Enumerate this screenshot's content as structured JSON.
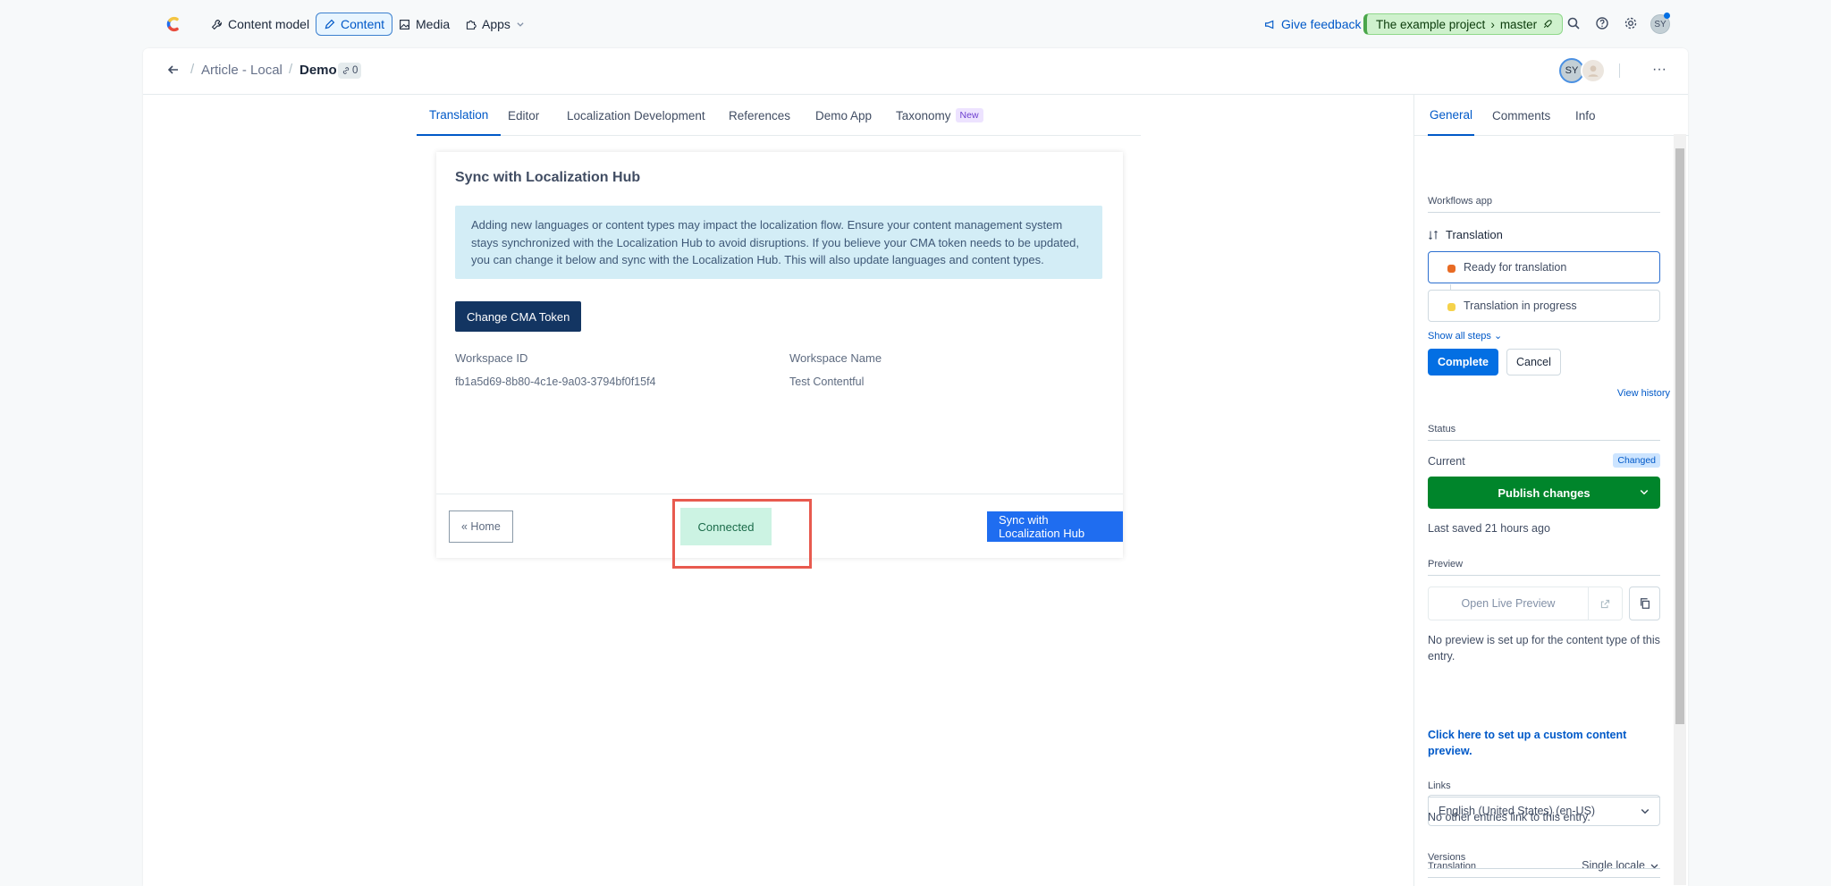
{
  "nav": {
    "content_model": "Content model",
    "content": "Content",
    "media": "Media",
    "apps": "Apps",
    "feedback": "Give feedback",
    "project": "The example project",
    "environment": "master",
    "user_initials": "SY"
  },
  "entry": {
    "parent": "Article - Local",
    "title": "Demo",
    "reference_count": "0",
    "avatar_initials": "SY"
  },
  "tabs": [
    "Translation",
    "Editor",
    "Localization Development",
    "References",
    "Demo App",
    "Taxonomy"
  ],
  "tab_badge": "New",
  "panel": {
    "title": "Sync with Localization Hub",
    "notice": "Adding new languages or content types may impact the localization flow. Ensure your content management system stays synchronized with the Localization Hub to avoid disruptions. If you believe your CMA token needs to be updated, you can change it below and sync with the Localization Hub. This will also update languages and content types.",
    "cma_button": "Change CMA Token",
    "workspace_id_label": "Workspace ID",
    "workspace_id": "fb1a5d69-8b80-4c1e-9a03-3794bf0f15f4",
    "workspace_name_label": "Workspace Name",
    "workspace_name": "Test Contentful",
    "home_button": "« Home",
    "status": "Connected",
    "sync_button": "Sync with Localization Hub"
  },
  "sidebar": {
    "tabs": [
      "General",
      "Comments",
      "Info"
    ],
    "workflows_heading": "Workflows app",
    "workflow_name": "Translation",
    "steps": [
      {
        "label": "Ready for translation",
        "color": "#e86b24"
      },
      {
        "label": "Translation in progress",
        "color": "#f5d24b"
      }
    ],
    "show_all_steps": "Show all steps",
    "complete": "Complete",
    "cancel": "Cancel",
    "view_history": "View history",
    "status_heading": "Status",
    "current_label": "Current",
    "changed_badge": "Changed",
    "publish": "Publish changes",
    "last_saved": "Last saved 21 hours ago",
    "preview_heading": "Preview",
    "open_live_preview": "Open Live Preview",
    "no_preview": "No preview is set up for the content type of this entry.",
    "setup_link": "Click here to set up a custom content preview.",
    "links_heading": "Links",
    "no_links": "No other entries link to this entry.",
    "translation_heading": "Translation",
    "locale_mode": "Single locale",
    "locale": "English (United States) (en-US)",
    "versions_heading": "Versions"
  }
}
